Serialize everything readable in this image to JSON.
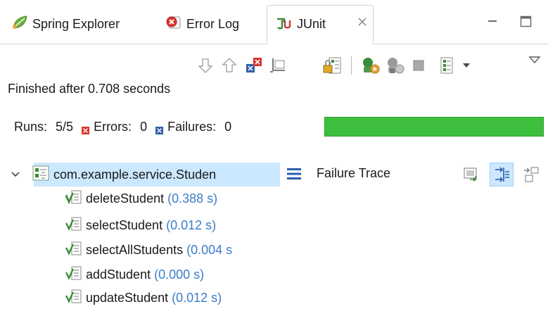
{
  "tabs": [
    {
      "label": "Spring Explorer",
      "icon": "spring-leaf-icon"
    },
    {
      "label": "Error Log",
      "icon": "error-log-icon"
    },
    {
      "label": "JUnit",
      "icon": "junit-icon",
      "active": true
    }
  ],
  "status": {
    "finished_text": "Finished after 0.708 seconds"
  },
  "counters": {
    "runs_label": "Runs:",
    "runs_value": "5/5",
    "errors_label": "Errors:",
    "errors_value": "0",
    "failures_label": "Failures:",
    "failures_value": "0",
    "progress_fraction": 1.0,
    "progress_color": "#3dbf3d"
  },
  "tree": {
    "root_label": "com.example.service.Studen",
    "children": [
      {
        "name": "deleteStudent",
        "time": "(0.388 s)"
      },
      {
        "name": "selectStudent",
        "time": "(0.012 s)"
      },
      {
        "name": "selectAllStudents",
        "time": "(0.004 s"
      },
      {
        "name": "addStudent",
        "time": "(0.000 s)"
      },
      {
        "name": "updateStudent",
        "time": "(0.012 s)"
      }
    ]
  },
  "failure_trace": {
    "title": "Failure Trace"
  },
  "colors": {
    "selection": "#cce8ff",
    "time_text": "#3a7dc9",
    "error_red": "#d9352f",
    "failure_blue": "#2f5ea8"
  }
}
